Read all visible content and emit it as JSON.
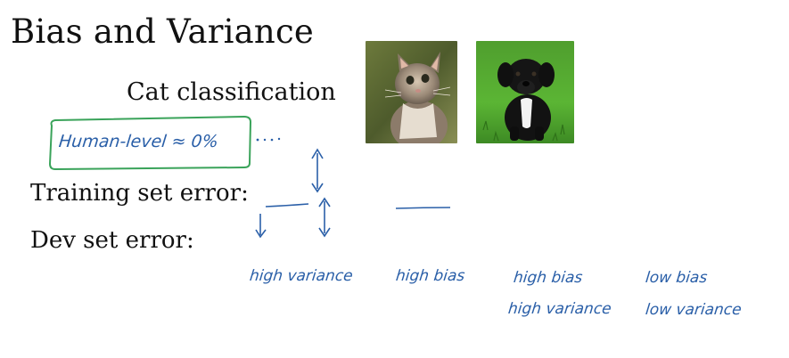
{
  "slide": {
    "title": "Bias and Variance",
    "subtitle": "Cat classification",
    "training_label": "Training set error:",
    "dev_label": "Dev set error:"
  },
  "annotations": {
    "human_level": "Human-level ≈ 0%",
    "cases": [
      {
        "line1": "high variance",
        "line2": ""
      },
      {
        "line1": "high bias",
        "line2": ""
      },
      {
        "line1": "high bias",
        "line2": "high variance"
      },
      {
        "line1": "low bias",
        "line2": "low variance"
      }
    ]
  },
  "images": {
    "cat": "kitten-photo",
    "dog": "puppy-photo"
  },
  "colors": {
    "ink_blue": "#2a5fa8",
    "ink_green": "#3aa35a"
  }
}
